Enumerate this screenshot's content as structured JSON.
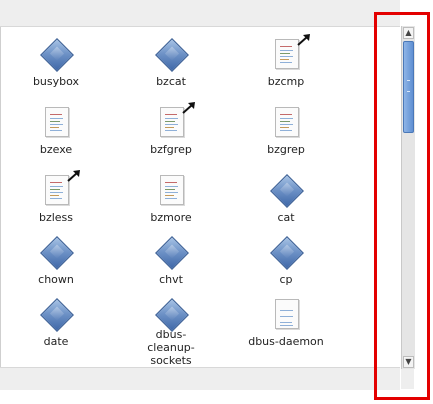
{
  "files": [
    {
      "name": "busybox",
      "icon": "executable-icon"
    },
    {
      "name": "bzcat",
      "icon": "executable-icon"
    },
    {
      "name": "bzcmp",
      "icon": "symlink-document-icon"
    },
    {
      "name": "bzexe",
      "icon": "document-icon"
    },
    {
      "name": "bzfgrep",
      "icon": "symlink-document-icon"
    },
    {
      "name": "bzgrep",
      "icon": "document-icon"
    },
    {
      "name": "bzless",
      "icon": "symlink-document-icon"
    },
    {
      "name": "bzmore",
      "icon": "document-icon"
    },
    {
      "name": "cat",
      "icon": "executable-icon"
    },
    {
      "name": "chown",
      "icon": "executable-icon"
    },
    {
      "name": "chvt",
      "icon": "executable-icon"
    },
    {
      "name": "cp",
      "icon": "executable-icon"
    },
    {
      "name": "date",
      "icon": "executable-icon"
    },
    {
      "name": "dbus-cleanup-sockets",
      "icon": "executable-icon"
    },
    {
      "name": "dbus-daemon",
      "icon": "document-icon"
    }
  ],
  "scrollbar": {
    "position": 0.0
  },
  "colors": {
    "highlight": "#e30000",
    "thumb": "#5f8fd3"
  }
}
